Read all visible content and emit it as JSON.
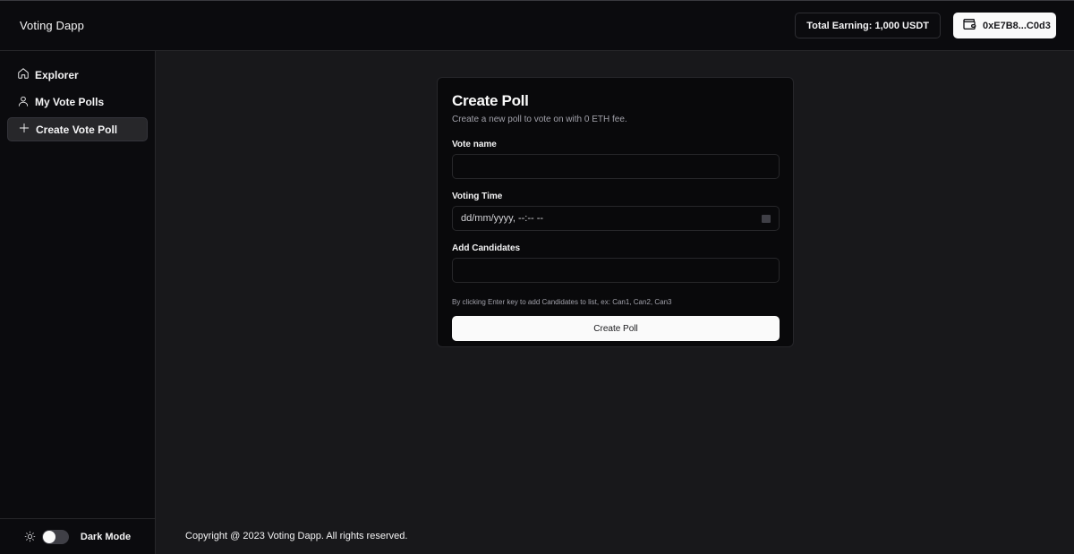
{
  "header": {
    "brand": "Voting Dapp",
    "earning": "Total Earning: 1,000 USDT",
    "wallet": "0xE7B8...C0d3",
    "wallet_icon": "wallet-icon"
  },
  "sidebar": {
    "items": [
      {
        "label": "Explorer",
        "icon": "home-icon",
        "active": false
      },
      {
        "label": "My Vote Polls",
        "icon": "user-icon",
        "active": false
      },
      {
        "label": "Create Vote Poll",
        "icon": "plus-icon",
        "active": true
      }
    ],
    "footer": {
      "theme_icon": "sun-icon",
      "mode_label": "Dark Mode",
      "dark_mode_on": false
    }
  },
  "form": {
    "title": "Create Poll",
    "subtitle": "Create a new poll to vote on with 0 ETH fee.",
    "vote_name_label": "Vote name",
    "vote_name_value": "",
    "voting_time_label": "Voting Time",
    "voting_time_value": "dd/mm/yyyy, --:-- --",
    "candidates_label": "Add Candidates",
    "candidates_value": "",
    "hint": "By clicking Enter key to add Candidates to list, ex: Can1, Can2, Can3",
    "submit_label": "Create Poll"
  },
  "footer": {
    "copyright": "Copyright @ 2023 Voting Dapp. All rights reserved."
  },
  "colors": {
    "background": "#18181b",
    "panel": "#09090b",
    "border": "#27272a",
    "primary": "#fafafa"
  }
}
